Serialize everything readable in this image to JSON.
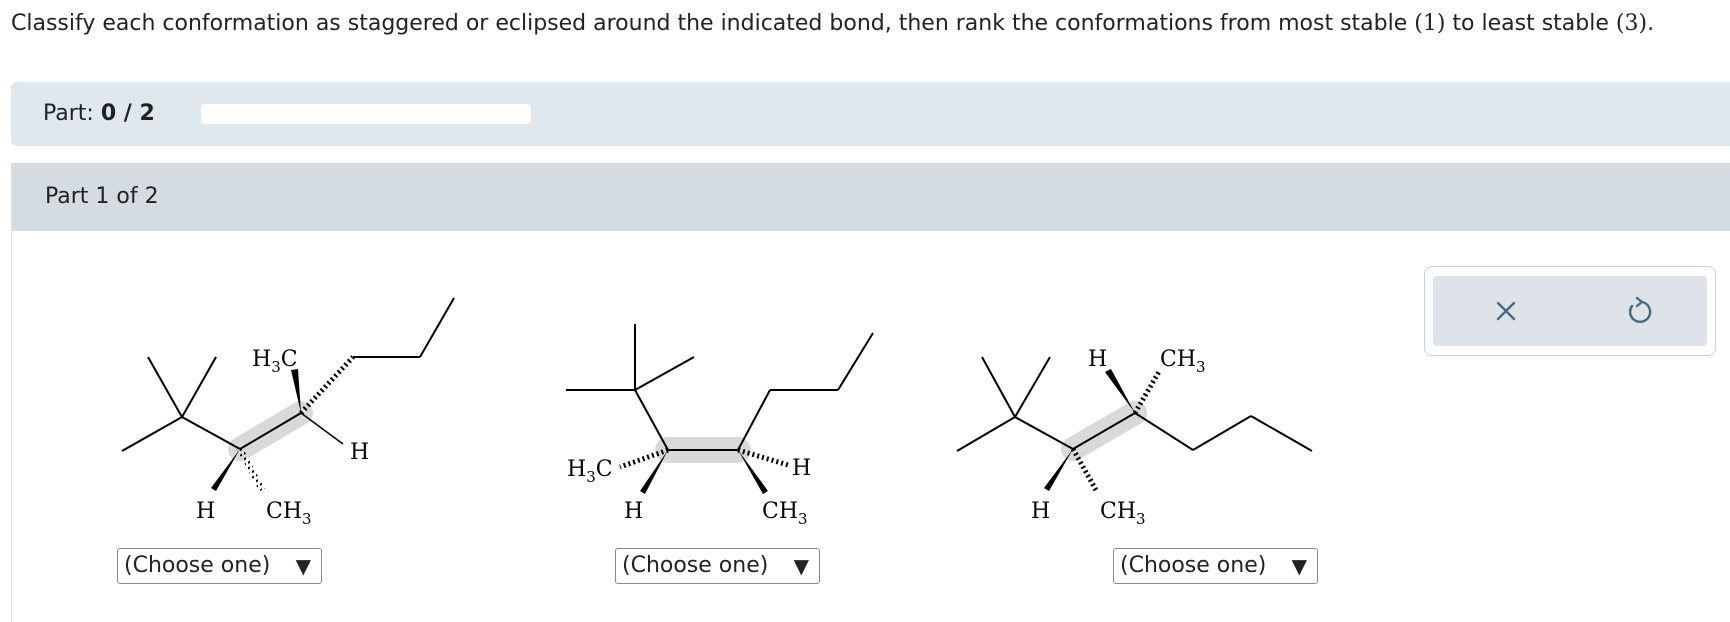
{
  "question": {
    "text_before": "Classify each conformation as staggered or eclipsed around the indicated bond, then rank the conformations from most stable ",
    "rank_most": "(1)",
    "text_middle": " to least stable ",
    "rank_least": "(3)",
    "text_after": "."
  },
  "progress": {
    "label": "Part:",
    "value_text": "0 / 2",
    "fraction": 0
  },
  "part": {
    "header": "Part 1 of 2"
  },
  "molecules": [
    {
      "labels": {
        "h3c": "H",
        "h3c_sub": "3",
        "h3c_tail": "C",
        "h_right": "H",
        "h_left": "H",
        "ch3": "CH",
        "ch3_sub": "3"
      },
      "select": {
        "value": "(Choose one)"
      }
    },
    {
      "labels": {
        "h3c": "H",
        "h3c_sub": "3",
        "h3c_tail": "C",
        "h_right": "H",
        "h_left": "H",
        "ch3": "CH",
        "ch3_sub": "3"
      },
      "select": {
        "value": "(Choose one)"
      }
    },
    {
      "labels": {
        "h_top": "H",
        "ch3_top": "CH",
        "ch3_top_sub": "3",
        "h_left": "H",
        "ch3": "CH",
        "ch3_sub": "3"
      },
      "select": {
        "value": "(Choose one)"
      }
    }
  ],
  "select_arrow_glyph": "▼",
  "tools": {
    "clear_icon": "x-icon",
    "undo_icon": "undo-icon"
  },
  "colors": {
    "progress_bg": "#dfe7ef",
    "part_header_bg": "#d4dce1",
    "tool_bg": "#dde3e8",
    "tool_icon": "#4a6a7a",
    "highlight": "#d9d9d9"
  }
}
